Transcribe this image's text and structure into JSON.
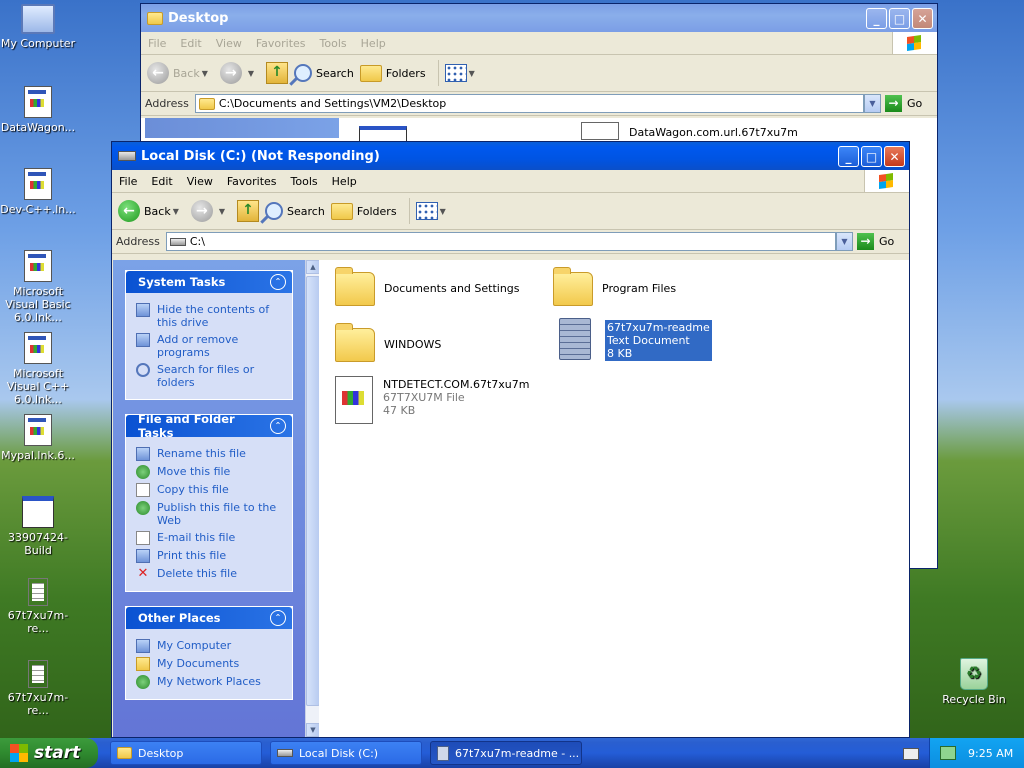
{
  "desktop": {
    "icons": [
      {
        "label": "My Computer",
        "icon": "my-computer-icon"
      },
      {
        "label": "DataWagon...",
        "icon": "app-shortcut-icon"
      },
      {
        "label": "Dev-C++.ln...",
        "icon": "app-shortcut-icon"
      },
      {
        "label": "Microsoft Visual Basic 6.0.lnk...",
        "icon": "app-shortcut-icon"
      },
      {
        "label": "Microsoft Visual C++ 6.0.lnk...",
        "icon": "app-shortcut-icon"
      },
      {
        "label": "Mypal.lnk.6...",
        "icon": "app-shortcut-icon"
      },
      {
        "label": "33907424-Build",
        "icon": "window-icon"
      },
      {
        "label": "67t7xu7m-re...",
        "icon": "text-file-icon"
      },
      {
        "label": "67t7xu7m-re...",
        "icon": "text-file-icon"
      },
      {
        "label": "Recycle Bin",
        "icon": "recycle-bin-icon"
      }
    ]
  },
  "desktop_window": {
    "title": "Desktop",
    "menu": [
      "File",
      "Edit",
      "View",
      "Favorites",
      "Tools",
      "Help"
    ],
    "toolbar": {
      "back": "Back",
      "search": "Search",
      "folders": "Folders"
    },
    "address_label": "Address",
    "address_value": "C:\\Documents and Settings\\VM2\\Desktop",
    "go": "Go",
    "visible_item": "DataWagon.com.url.67t7xu7m"
  },
  "main_window": {
    "title": "Local Disk (C:) (Not Responding)",
    "menu": [
      "File",
      "Edit",
      "View",
      "Favorites",
      "Tools",
      "Help"
    ],
    "toolbar": {
      "back": "Back",
      "search": "Search",
      "folders": "Folders"
    },
    "address_label": "Address",
    "address_value": "C:\\",
    "go": "Go",
    "system_tasks": {
      "title": "System Tasks",
      "items": [
        "Hide the contents of this drive",
        "Add or remove programs",
        "Search for files or folders"
      ]
    },
    "file_folder_tasks": {
      "title": "File and Folder Tasks",
      "items": [
        "Rename this file",
        "Move this file",
        "Copy this file",
        "Publish this file to the Web",
        "E-mail this file",
        "Print this file",
        "Delete this file"
      ]
    },
    "other_places": {
      "title": "Other Places",
      "items": [
        "My Computer",
        "My Documents",
        "My Network Places"
      ]
    },
    "files": [
      {
        "name": "Documents and Settings",
        "type": "folder"
      },
      {
        "name": "Program Files",
        "type": "folder"
      },
      {
        "name": "WINDOWS",
        "type": "folder"
      },
      {
        "name": "67t7xu7m-readme",
        "line2": "Text Document",
        "line3": "8 KB",
        "type": "text",
        "selected": true
      },
      {
        "name": "NTDETECT.COM.67t7xu7m",
        "line2": "67T7XU7M File",
        "line3": "47 KB",
        "type": "file"
      }
    ]
  },
  "taskbar": {
    "start": "start",
    "buttons": [
      "Desktop",
      "Local Disk (C:)",
      "67t7xu7m-readme - ..."
    ],
    "time": "9:25 AM"
  }
}
